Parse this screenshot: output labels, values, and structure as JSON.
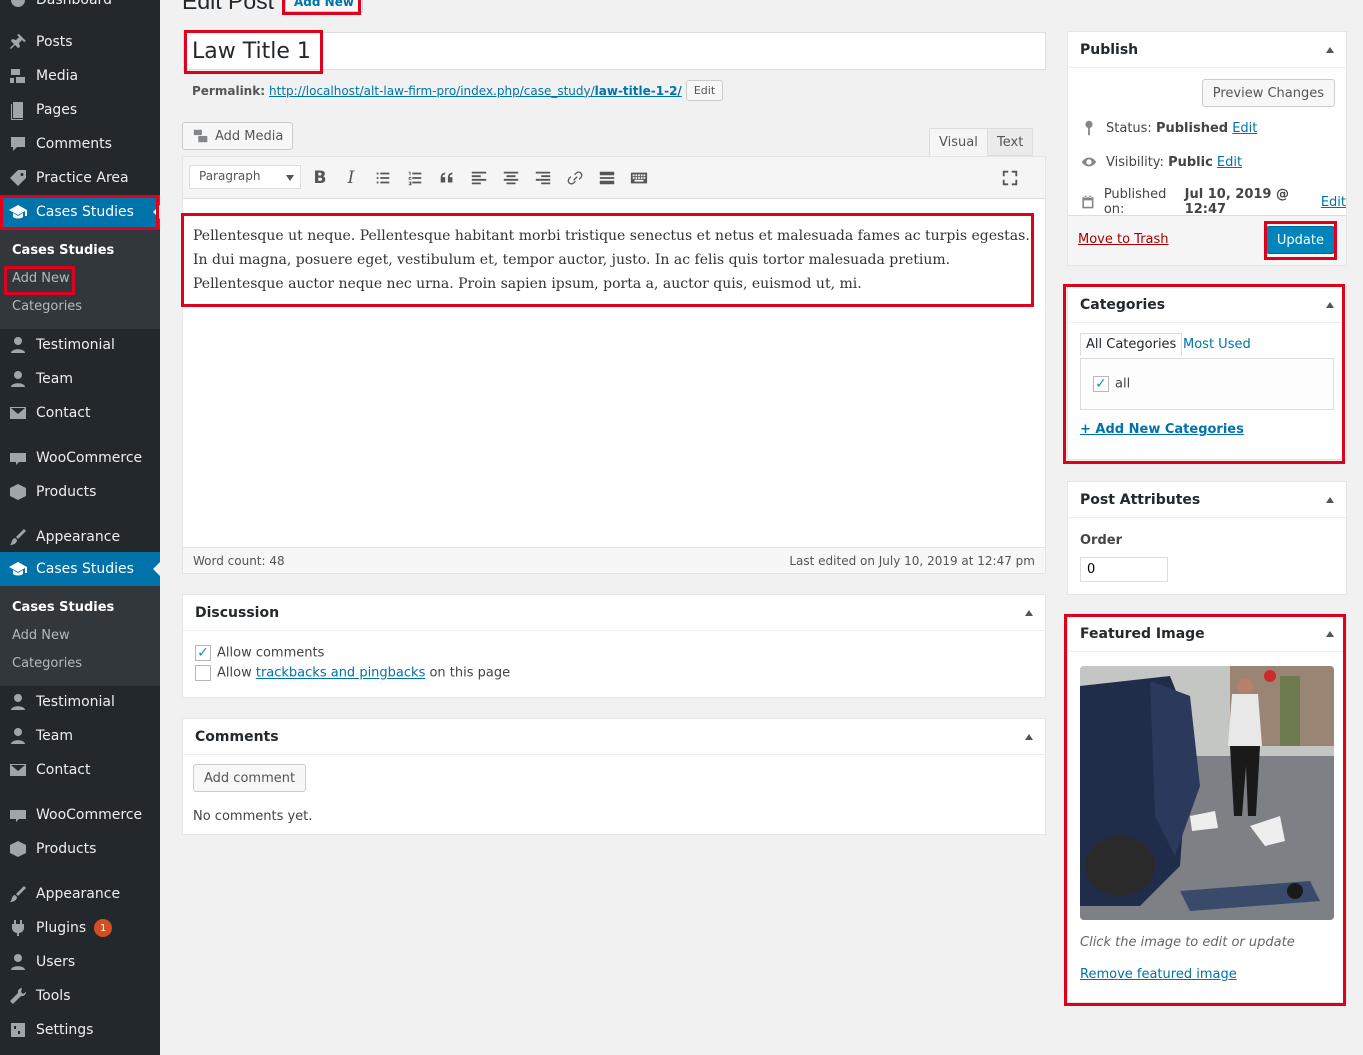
{
  "sidebar": {
    "top_cut": "Dashboard",
    "items": [
      {
        "label": "Posts",
        "icon": "pin-icon"
      },
      {
        "label": "Media",
        "icon": "media-icon"
      },
      {
        "label": "Pages",
        "icon": "page-icon"
      },
      {
        "label": "Comments",
        "icon": "comment-icon"
      },
      {
        "label": "Practice Area",
        "icon": "tag-icon"
      },
      {
        "label": "Cases Studies",
        "icon": "graduation-cap-icon"
      },
      {
        "label": "Testimonial",
        "icon": "user-icon"
      },
      {
        "label": "Team",
        "icon": "user-icon"
      },
      {
        "label": "Contact",
        "icon": "mail-icon"
      },
      {
        "label": "WooCommerce",
        "icon": "woo-icon"
      },
      {
        "label": "Products",
        "icon": "box-icon"
      },
      {
        "label": "Appearance",
        "icon": "brush-icon"
      },
      {
        "label": "Cases Studies",
        "icon": "graduation-cap-icon"
      },
      {
        "label": "Testimonial",
        "icon": "user-icon"
      },
      {
        "label": "Team",
        "icon": "user-icon"
      },
      {
        "label": "Contact",
        "icon": "mail-icon"
      },
      {
        "label": "WooCommerce",
        "icon": "woo-icon"
      },
      {
        "label": "Products",
        "icon": "box-icon"
      },
      {
        "label": "Appearance",
        "icon": "brush-icon"
      },
      {
        "label": "Plugins",
        "icon": "plugin-icon",
        "badge": "1"
      },
      {
        "label": "Users",
        "icon": "user-icon"
      },
      {
        "label": "Tools",
        "icon": "wrench-icon"
      },
      {
        "label": "Settings",
        "icon": "settings-icon"
      }
    ],
    "submenu1": [
      "Cases Studies",
      "Add New",
      "Categories"
    ],
    "submenu2": [
      "Cases Studies",
      "Add New",
      "Categories"
    ]
  },
  "header": {
    "title": "Edit Post",
    "add_new": "Add New"
  },
  "post": {
    "title": "Law Title 1",
    "permalink_label": "Permalink:",
    "permalink_base": "http://localhost/alt-law-firm-pro/index.php/case_study/",
    "permalink_slug": "law-title-1-2/",
    "permalink_edit": "Edit"
  },
  "editor": {
    "add_media": "Add Media",
    "tab_visual": "Visual",
    "tab_text": "Text",
    "format": "Paragraph",
    "content": "Pellentesque ut neque. Pellentesque habitant morbi tristique senectus et netus et malesuada fames ac turpis egestas. In dui magna, posuere eget, vestibulum et, tempor auctor, justo. In ac felis quis tortor malesuada pretium. Pellentesque auctor neque nec urna. Proin sapien ipsum, porta a, auctor quis, euismod ut, mi.",
    "word_count": "Word count: 48",
    "last_edited": "Last edited on July 10, 2019 at 12:47 pm"
  },
  "discussion": {
    "title": "Discussion",
    "allow_comments": "Allow comments",
    "allow_prefix": "Allow ",
    "trackbacks_link": "trackbacks and pingbacks",
    "allow_suffix": " on this page"
  },
  "comments": {
    "title": "Comments",
    "add_comment": "Add comment",
    "none": "No comments yet."
  },
  "publish": {
    "title": "Publish",
    "preview": "Preview Changes",
    "status_label": "Status:",
    "status_value": "Published",
    "visibility_label": "Visibility:",
    "visibility_value": "Public",
    "published_label": "Published on:",
    "published_value": "Jul 10, 2019 @ 12:47",
    "edit": "Edit",
    "trash": "Move to Trash",
    "update": "Update"
  },
  "categories": {
    "title": "Categories",
    "tab_all": "All Categories",
    "tab_used": "Most Used",
    "item": "all",
    "add_new": "+ Add New Categories"
  },
  "attributes": {
    "title": "Post Attributes",
    "order_label": "Order",
    "order_value": "0"
  },
  "featured": {
    "title": "Featured Image",
    "hint": "Click the image to edit or update",
    "remove": "Remove featured image"
  },
  "colors": {
    "sidebar_bg": "#23282d",
    "accent": "#0073aa",
    "highlight": "#e0001b"
  }
}
